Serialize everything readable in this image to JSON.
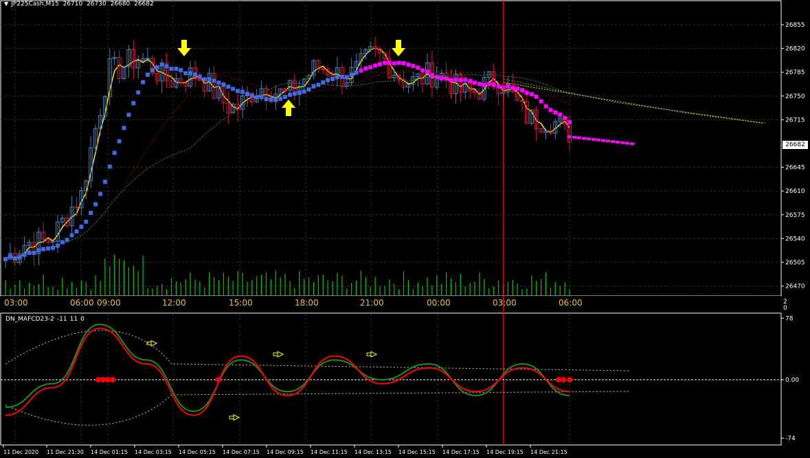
{
  "window": {
    "symbol": "JP225Cash,M15",
    "ohlc": [
      "26710",
      "26730",
      "26680",
      "26682"
    ]
  },
  "current_price_tag": "26682",
  "main_price_axis": [
    "26855",
    "26820",
    "26785",
    "26750",
    "26715",
    "26645",
    "26610",
    "26575",
    "26540",
    "26505",
    "26470"
  ],
  "main_time_axis": [
    "03:00",
    "06:00",
    "09:00",
    "12:00",
    "15:00",
    "18:00",
    "21:00",
    "00:00",
    "03:00",
    "06:00"
  ],
  "volume_scale": [
    "2",
    "0"
  ],
  "indicator": {
    "title": "DN_MAFCD23-2",
    "params": [
      "-11",
      "11",
      "0"
    ],
    "axis": [
      "78",
      "0.00",
      "-74"
    ]
  },
  "bottom_time_axis": [
    "11 Dec 2020",
    "11 Dec 21:30",
    "14 Dec 01:15",
    "14 Dec 03:15",
    "14 Dec 05:15",
    "14 Dec 07:15",
    "14 Dec 09:15",
    "14 Dec 11:15",
    "14 Dec 13:15",
    "14 Dec 15:15",
    "14 Dec 17:15",
    "14 Dec 19:15",
    "14 Dec 21:15"
  ],
  "colors": {
    "background": "#000000",
    "grid": "#3a2e14",
    "bull_candle": "#4682b4",
    "bear_candle": "#dc143c",
    "fast_ma": "#ffd700",
    "trend_blue": "#4169e1",
    "trend_magenta": "#ff00ff",
    "signal_arrow": "#ffff00",
    "volume": "#00c800",
    "macd_green": "#228b22",
    "macd_red": "#ff0000",
    "vertical_marker": "#ff0000"
  },
  "chart_data": [
    {
      "type": "candlestick",
      "title": "JP225Cash,M15",
      "ylim": [
        26465,
        26875
      ],
      "close_by_time": {
        "x": [
          "11 Dec 03:00",
          "11 Dec 06:00",
          "11 Dec 09:00",
          "14 Dec 12:00",
          "14 Dec 15:00",
          "14 Dec 18:00",
          "14 Dec 21:00",
          "15 Dec 00:00",
          "15 Dec 03:00",
          "15 Dec 06:00"
        ],
        "values": [
          26510,
          26590,
          26800,
          26785,
          26740,
          26775,
          26800,
          26770,
          26760,
          26682
        ]
      },
      "signals": [
        {
          "direction": "down",
          "x": "12:00",
          "price": 26820
        },
        {
          "direction": "up",
          "x": "18:00",
          "price": 26740
        },
        {
          "direction": "down",
          "x": "21:00",
          "price": 26820
        }
      ],
      "last_price": 26682
    },
    {
      "type": "line",
      "title": "DN_MAFCD23-2 -11 11 0",
      "ylim": [
        -74,
        78
      ],
      "series": [
        {
          "values": [
            -35,
            -5,
            70,
            25,
            -40,
            25,
            -15,
            25,
            0,
            20,
            -20,
            20,
            -20
          ]
        },
        {
          "values": [
            -45,
            -10,
            65,
            20,
            -45,
            30,
            -20,
            30,
            -5,
            15,
            -15,
            15,
            -15
          ]
        }
      ]
    }
  ]
}
